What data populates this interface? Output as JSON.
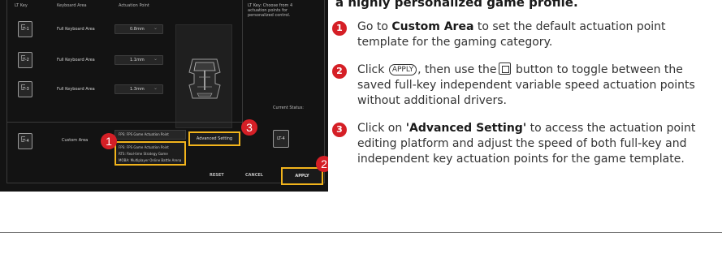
{
  "software": {
    "columns": {
      "lt_key": "LT Key",
      "keyboard_area": "Keyboard Area",
      "actuation_point": "Actuation Point"
    },
    "rows": [
      {
        "key": "LT-1",
        "area": "Full Keyboard Area",
        "value": "0.8mm"
      },
      {
        "key": "LT-2",
        "area": "Full Keyboard Area",
        "value": "1.1mm"
      },
      {
        "key": "LT-3",
        "area": "Full Keyboard Area",
        "value": "1.3mm"
      }
    ],
    "info_text": "LT Key: Choose from 4 actuation points for personalized control.",
    "current_status_label": "Current Status:",
    "current_status_key": "LT-4",
    "custom_row": {
      "key": "LT-4",
      "area": "Custom Area",
      "field_value": "FPS: FPS Game Actuation Point"
    },
    "dropdown_options": [
      "FPS: FPS Game Actuation Point",
      "RTS: Real-time Strategy Game",
      "MOBA: Multiplayer Online Battle Arena"
    ],
    "advanced_setting_label": "Advanced Setting",
    "reset_label": "RESET",
    "cancel_label": "CANCEL",
    "apply_label": "APPLY",
    "callouts": [
      "1",
      "2",
      "3"
    ]
  },
  "instructions": {
    "heading": "a highly personalized game profile.",
    "steps": [
      {
        "number": "1",
        "pre": "Go to ",
        "bold": "Custom Area",
        "post": " to set the default actuation point template for the gaming category."
      },
      {
        "number": "2",
        "pre": "Click ",
        "chip": "APPLY",
        "mid": ", then use the",
        "post": " button to toggle between the saved full-key independent variable speed actuation points without additional drivers."
      },
      {
        "number": "3",
        "pre": "Click on ",
        "bold": "'Advanced Setting'",
        "post": " to access the actuation point editing platform and adjust the speed of both full-key and independent key actuation points for the game template."
      }
    ]
  },
  "colors": {
    "accent_red": "#d51f26",
    "highlight_yellow": "#f2b41c",
    "panel_bg": "#131313"
  }
}
